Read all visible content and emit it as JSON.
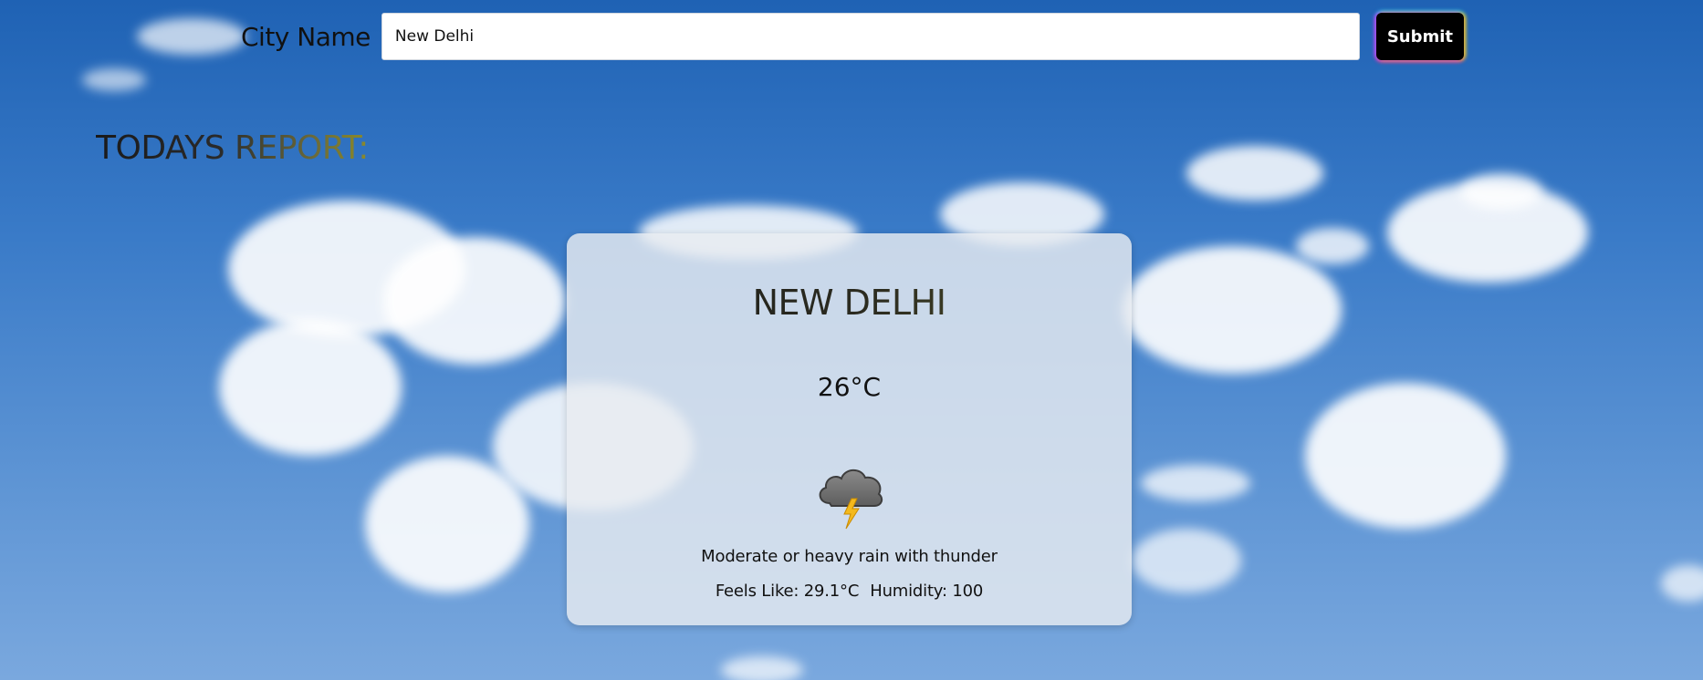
{
  "search": {
    "label": "City Name",
    "value": "New Delhi",
    "submit_label": "Submit"
  },
  "report": {
    "heading": "TODAYS REPORT:"
  },
  "weather": {
    "city": "NEW DELHI",
    "temperature": "26°C",
    "icon": "thunderstorm-cloud-icon",
    "condition": "Moderate or heavy rain with thunder",
    "feels_like": "Feels Like: 29.1°C",
    "humidity": "Humidity: 100"
  },
  "colors": {
    "sky_top": "#1f62b4",
    "sky_bottom": "#7aa8de",
    "button_bg": "#000000",
    "card_bg": "#e8ebf0"
  }
}
